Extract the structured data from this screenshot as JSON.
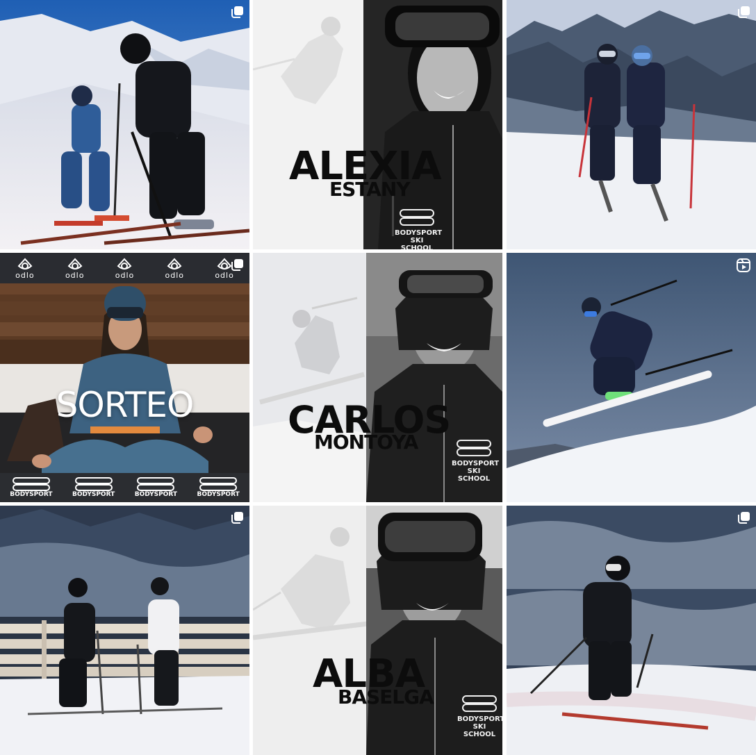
{
  "feed": {
    "posts": [
      {
        "type": "carousel",
        "icon": "carousel-icon"
      },
      {
        "type": "image",
        "name_first": "ALEXIA",
        "name_last": "ESTANY",
        "school_line1": "BODYSPORT",
        "school_line2": "SKI SCHOOL"
      },
      {
        "type": "carousel",
        "icon": "carousel-icon"
      },
      {
        "type": "carousel",
        "icon": "carousel-icon",
        "title": "SORTEO",
        "odlo_logo": "odlo",
        "bodysport_logo": "BODYSPORT"
      },
      {
        "type": "image",
        "name_first": "CARLOS",
        "name_last": "MONTOYA",
        "school_line1": "BODYSPORT",
        "school_line2": "SKI SCHOOL"
      },
      {
        "type": "reel",
        "icon": "reel-icon"
      },
      {
        "type": "carousel",
        "icon": "carousel-icon"
      },
      {
        "type": "image",
        "name_first": "ALBA",
        "name_last": "BASELGA",
        "school_line1": "BODYSPORT",
        "school_line2": "SKI SCHOOL"
      },
      {
        "type": "carousel",
        "icon": "carousel-icon"
      }
    ]
  },
  "colors": {
    "snow": "#e9ecf2",
    "sky": "#3d6fb0",
    "jacket": "#1e2530",
    "text_dark": "#0c0c0c",
    "strip_dark": "#2a2c31"
  }
}
